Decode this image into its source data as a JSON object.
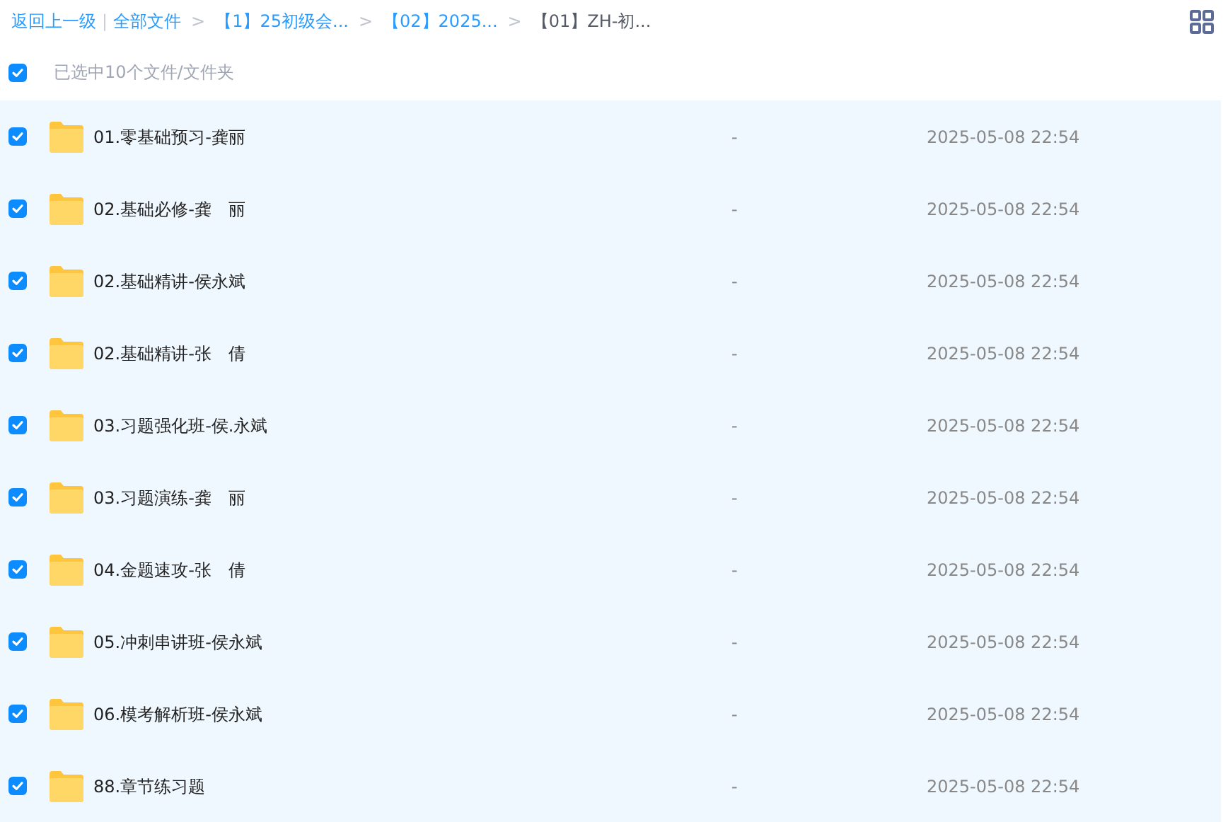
{
  "breadcrumb": {
    "back": "返回上一级",
    "separator": "|",
    "items": [
      {
        "label": "全部文件",
        "current": false
      },
      {
        "label": "【1】25初级会...",
        "current": false
      },
      {
        "label": "【02】2025...",
        "current": false
      },
      {
        "label": "【01】ZH-初...",
        "current": true
      }
    ],
    "arrow": ">"
  },
  "selection": {
    "checked": true,
    "summary": "已选中10个文件/文件夹"
  },
  "files": [
    {
      "name": "01.零基础预习-龚丽",
      "size": "-",
      "modified": "2025-05-08 22:54",
      "checked": true
    },
    {
      "name": "02.基础必修-龚　丽",
      "size": "-",
      "modified": "2025-05-08 22:54",
      "checked": true
    },
    {
      "name": "02.基础精讲-侯永斌",
      "size": "-",
      "modified": "2025-05-08 22:54",
      "checked": true
    },
    {
      "name": "02.基础精讲-张　倩",
      "size": "-",
      "modified": "2025-05-08 22:54",
      "checked": true
    },
    {
      "name": "03.习题强化班-侯.永斌",
      "size": "-",
      "modified": "2025-05-08 22:54",
      "checked": true
    },
    {
      "name": "03.习题演练-龚　丽",
      "size": "-",
      "modified": "2025-05-08 22:54",
      "checked": true
    },
    {
      "name": "04.金题速攻-张　倩",
      "size": "-",
      "modified": "2025-05-08 22:54",
      "checked": true
    },
    {
      "name": "05.冲刺串讲班-侯永斌",
      "size": "-",
      "modified": "2025-05-08 22:54",
      "checked": true
    },
    {
      "name": "06.模考解析班-侯永斌",
      "size": "-",
      "modified": "2025-05-08 22:54",
      "checked": true
    },
    {
      "name": "88.章节练习题",
      "size": "-",
      "modified": "2025-05-08 22:54",
      "checked": true
    }
  ]
}
